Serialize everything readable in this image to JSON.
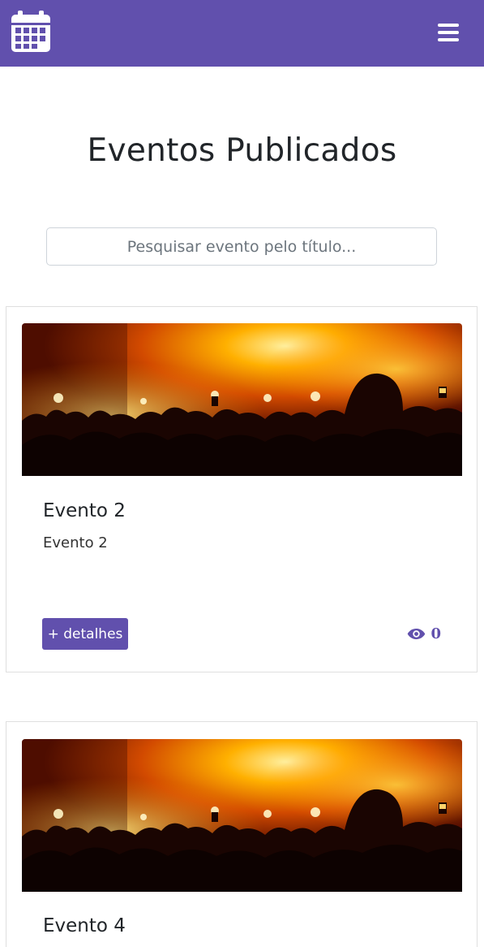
{
  "navbar": {
    "brand_icon": "calendar-icon",
    "menu_icon": "hamburger-menu-icon",
    "color": "#6150ad"
  },
  "page": {
    "title": "Eventos Publicados"
  },
  "search": {
    "placeholder": "Pesquisar evento pelo título..."
  },
  "events": [
    {
      "title": "Evento 2",
      "description": "Evento 2",
      "details_label": "+ detalhes",
      "views": "0",
      "image": "concert-crowd-image"
    },
    {
      "title": "Evento 4",
      "image": "concert-crowd-image"
    }
  ]
}
